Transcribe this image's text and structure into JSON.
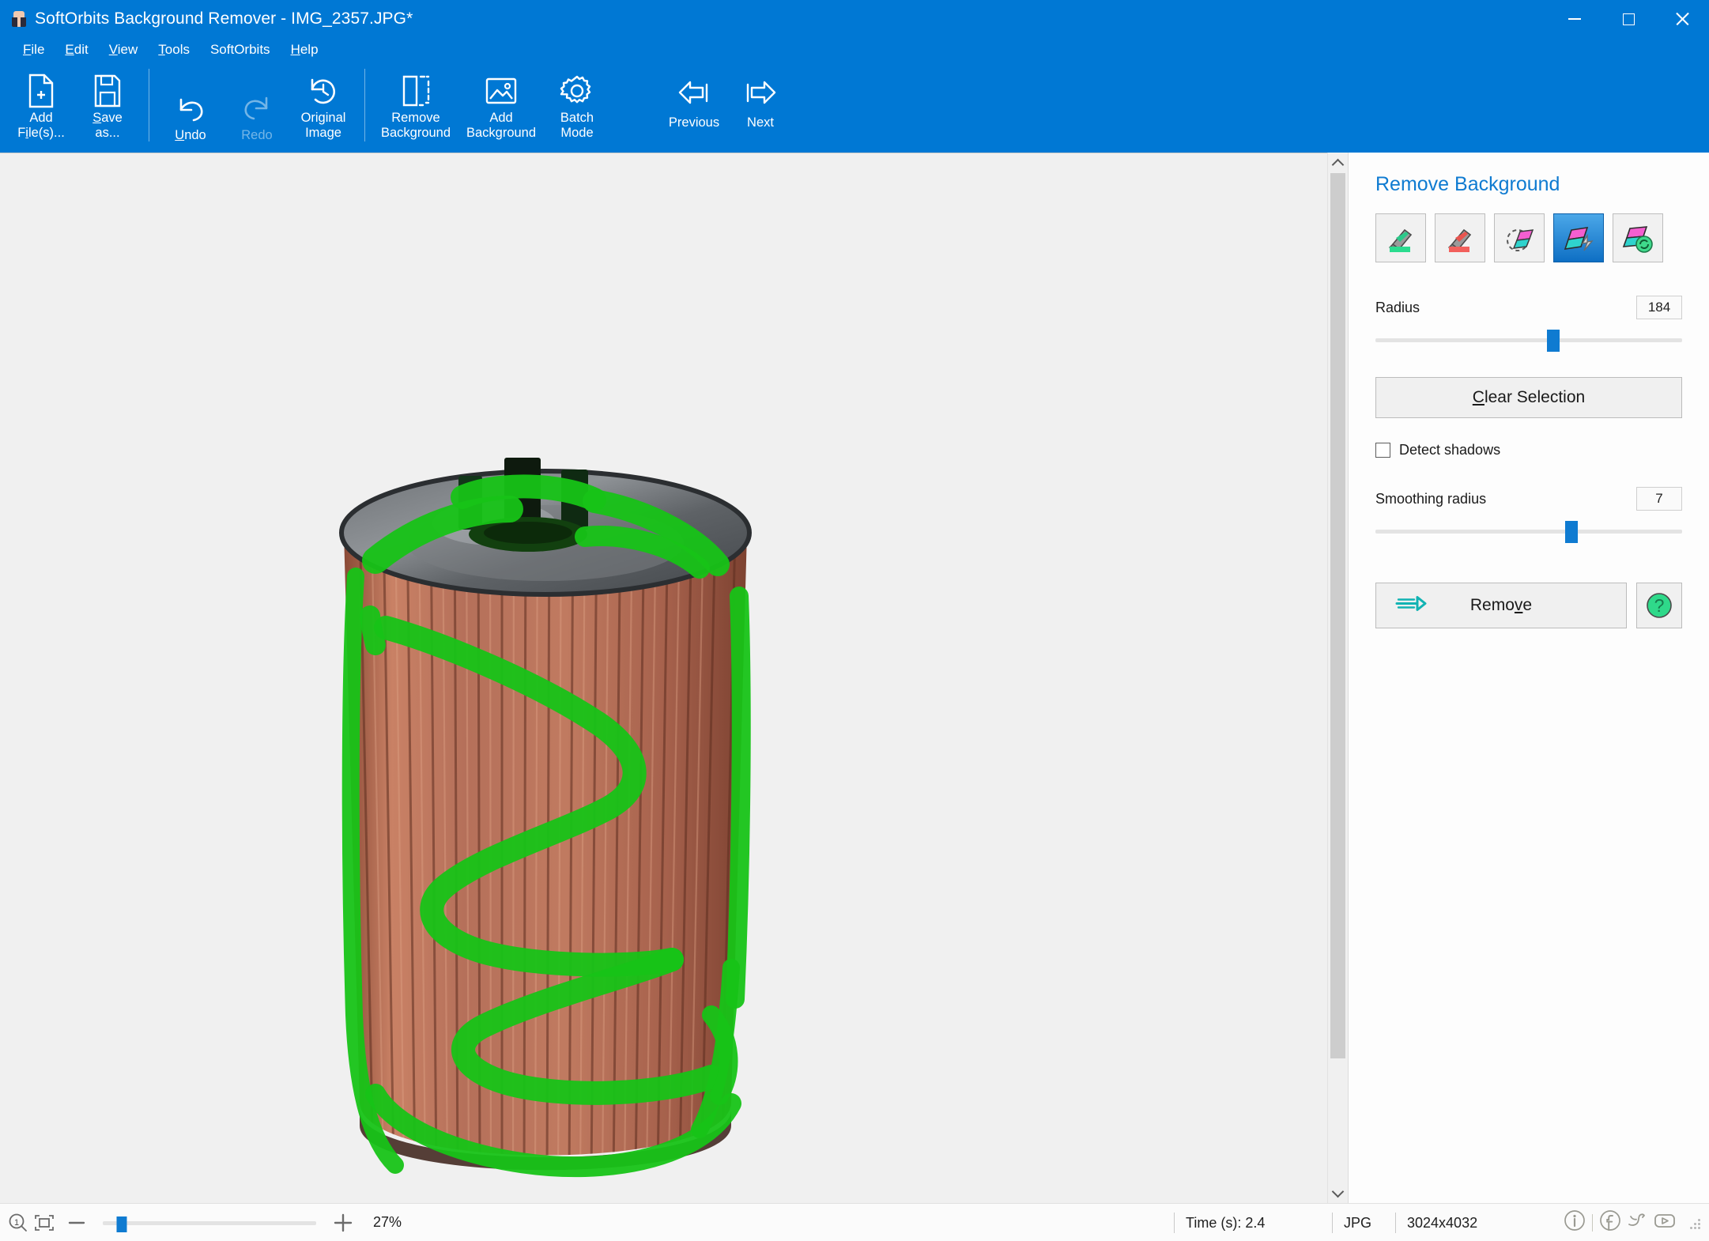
{
  "window": {
    "title": "SoftOrbits Background Remover - IMG_2357.JPG*",
    "app_icon": "app-icon",
    "minimize": "minimize-button",
    "maximize": "maximize-button",
    "close": "close-button",
    "titlebar_color": "#0078D4"
  },
  "menubar": {
    "items": [
      {
        "label": "File",
        "accel": "F"
      },
      {
        "label": "Edit",
        "accel": "E"
      },
      {
        "label": "View",
        "accel": "V"
      },
      {
        "label": "Tools",
        "accel": "T"
      },
      {
        "label": "SoftOrbits",
        "accel": ""
      },
      {
        "label": "Help",
        "accel": "H"
      }
    ]
  },
  "toolbar": {
    "add_files": "Add\nFile(s)...",
    "save_as": "Save\nas...",
    "undo": "Undo",
    "redo": "Redo",
    "original_image": "Original\nImage",
    "remove_background": "Remove\nBackground",
    "add_background": "Add\nBackground",
    "batch_mode": "Batch\nMode",
    "previous": "Previous",
    "next": "Next"
  },
  "panel": {
    "title": "Remove Background",
    "tools": [
      {
        "name": "marker-keep-tool",
        "tip": "Green marker - keep",
        "selected": false
      },
      {
        "name": "marker-remove-tool",
        "tip": "Red marker - remove",
        "selected": false
      },
      {
        "name": "eraser-tool",
        "tip": "Eraser",
        "selected": false
      },
      {
        "name": "magic-wand-tool",
        "tip": "Magic removal",
        "selected": true
      },
      {
        "name": "restore-tool",
        "tip": "Restore",
        "selected": false
      }
    ],
    "radius": {
      "label": "Radius",
      "value": "184",
      "percent": 58
    },
    "clear_selection": "Clear Selection",
    "clear_selection_accel": "C",
    "detect_shadows": {
      "label": "Detect shadows",
      "checked": false
    },
    "smoothing_radius": {
      "label": "Smoothing radius",
      "value": "7",
      "percent": 64
    },
    "remove": "Remove",
    "remove_accel": "v",
    "help": "?"
  },
  "statusbar": {
    "zoom_1to1_icon": "zoom-actual-size-icon",
    "fit_icon": "fit-to-window-icon",
    "minus": "−",
    "plus": "+",
    "zoom_percent": "27%",
    "zoom_slider_percent": 9,
    "time": "Time (s): 2.4",
    "format": "JPG",
    "dimensions": "3024x4032",
    "social": [
      "info-icon",
      "facebook-icon",
      "twitter-icon",
      "youtube-icon"
    ]
  },
  "canvas": {
    "background_color": "#F0F0F0",
    "marker_color": "#17C317",
    "image_name": "oil-filter-photo",
    "scroll_position_percent": 0
  }
}
